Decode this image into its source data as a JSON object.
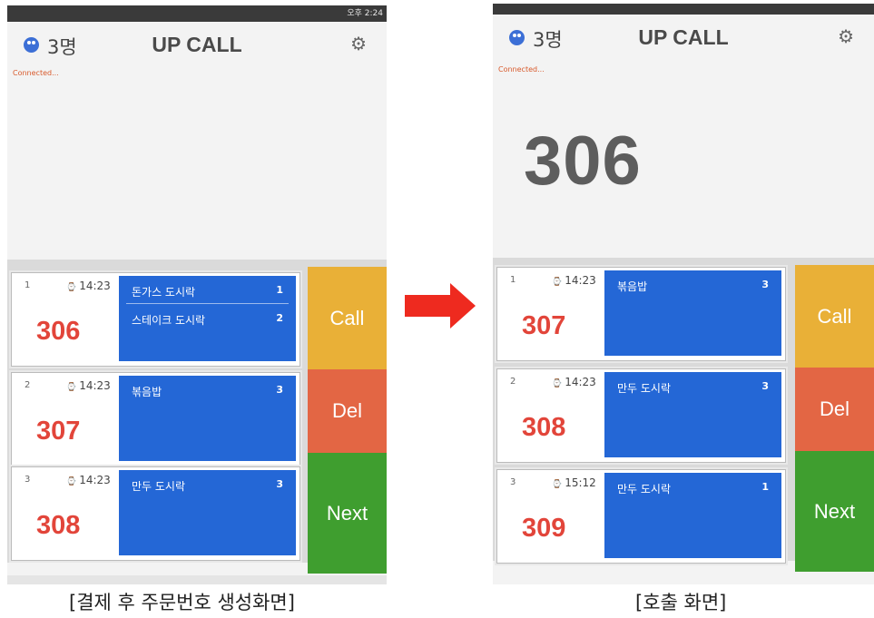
{
  "left_screen": {
    "status_text": "오후 2:24",
    "users_count": "3명",
    "title": "UP CALL",
    "connection_status": "Connected...",
    "orders": [
      {
        "index": "1",
        "time": "14:23",
        "number": "306",
        "items": [
          {
            "name": "돈가스 도시락",
            "qty": "1"
          },
          {
            "name": "스테이크 도시락",
            "qty": "2"
          }
        ]
      },
      {
        "index": "2",
        "time": "14:23",
        "number": "307",
        "items": [
          {
            "name": "볶음밥",
            "qty": "3"
          }
        ]
      },
      {
        "index": "3",
        "time": "14:23",
        "number": "308",
        "items": [
          {
            "name": "만두 도시락",
            "qty": "3"
          }
        ]
      }
    ],
    "buttons": {
      "call": "Call",
      "del": "Del",
      "next": "Next"
    }
  },
  "right_screen": {
    "users_count": "3명",
    "title": "UP CALL",
    "connection_status": "Connected...",
    "called_number": "306",
    "orders": [
      {
        "index": "1",
        "time": "14:23",
        "number": "307",
        "items": [
          {
            "name": "볶음밥",
            "qty": "3"
          }
        ]
      },
      {
        "index": "2",
        "time": "14:23",
        "number": "308",
        "items": [
          {
            "name": "만두 도시락",
            "qty": "3"
          }
        ]
      },
      {
        "index": "3",
        "time": "15:12",
        "number": "309",
        "items": [
          {
            "name": "만두 도시락",
            "qty": "1"
          }
        ]
      }
    ],
    "buttons": {
      "call": "Call",
      "del": "Del",
      "next": "Next"
    }
  },
  "captions": {
    "left": "[결제 후 주문번호 생성화면]",
    "right": "[호출 화면]"
  },
  "colors": {
    "call": "#e9b037",
    "del": "#e36644",
    "next": "#3f9e2f",
    "item_panel": "#2467d6",
    "order_number": "#e2453a",
    "arrow": "#ee2a1f"
  },
  "icons": {
    "users": "users-icon",
    "settings": "gear-icon",
    "arrow": "right-arrow-icon"
  }
}
